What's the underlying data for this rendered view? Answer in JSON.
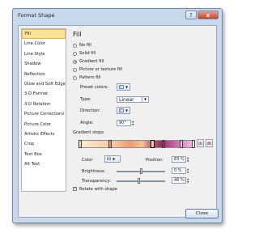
{
  "window": {
    "title": "Format Shape",
    "help_glyph": "?",
    "close_glyph": "x"
  },
  "nav": {
    "items": [
      "Fill",
      "Line Color",
      "Line Style",
      "Shadow",
      "Reflection",
      "Glow and Soft Edges",
      "3-D Format",
      "3-D Rotation",
      "Picture Corrections",
      "Picture Color",
      "Artistic Effects",
      "Crop",
      "Text Box",
      "Alt Text"
    ],
    "selected": "Fill"
  },
  "fill": {
    "heading": "Fill",
    "options": [
      "No fill",
      "Solid fill",
      "Gradient fill",
      "Picture or texture fill",
      "Pattern fill"
    ],
    "selected_option": "Gradient fill",
    "preset_label": "Preset colors:",
    "type_label": "Type:",
    "type_value": "Linear",
    "direction_label": "Direction:",
    "angle_label": "Angle:",
    "angle_value": "90°",
    "stops_label": "Gradient stops",
    "color_label": "Color",
    "position_label": "Position:",
    "position_value": "63 %",
    "brightness_label": "Brightness:",
    "brightness_value": "0 %",
    "brightness_level": 0.5,
    "transparency_label": "Transparency:",
    "transparency_value": "46 %",
    "transparency_level": 0.46,
    "rotate_label": "Rotate with shape",
    "rotate_checked": true,
    "stop_colors": [
      "#f7e0b8",
      "#e89a70",
      "#f4c9a0",
      "#9e2c63",
      "#f3c3e2"
    ]
  },
  "footer": {
    "close_label": "Close"
  },
  "icons": {
    "add_stop": "add-gradient-stop-icon",
    "remove_stop": "remove-gradient-stop-icon",
    "paint_bucket": "paint-bucket-icon"
  }
}
